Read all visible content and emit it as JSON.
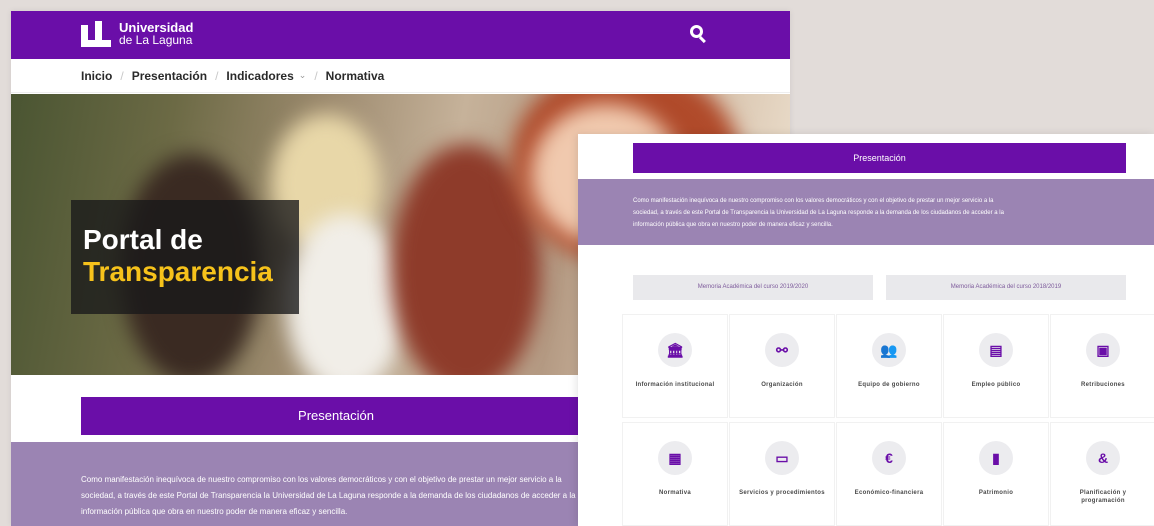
{
  "brand": {
    "line1": "Universidad",
    "line2": "de La Laguna",
    "color": "#6a0ea8"
  },
  "nav": {
    "items": [
      "Inicio",
      "Presentación",
      "Indicadores",
      "Normativa"
    ]
  },
  "hero": {
    "line1": "Portal de",
    "line2": "Transparencia"
  },
  "presentation": {
    "label": "Presentación",
    "text_lines": [
      "Como manifestación inequívoca de nuestro compromiso con los valores democráticos y con el objetivo de prestar un mejor servicio a la",
      "sociedad, a través de este Portal de Transparencia la Universidad de La Laguna responde a la demanda de los ciudadanos de acceder a la",
      "información pública que obra en nuestro poder de manera eficaz y sencilla."
    ]
  },
  "memorias": [
    "Memoria Académica del curso 2019/2020",
    "Memoria Académica del curso 2018/2019"
  ],
  "tiles": [
    {
      "label": "Información institucional",
      "icon": "bank-icon",
      "glyph": "🏛"
    },
    {
      "label": "Organización",
      "icon": "org-chart-icon",
      "glyph": "⚯"
    },
    {
      "label": "Equipo de gobierno",
      "icon": "team-icon",
      "glyph": "👥"
    },
    {
      "label": "Empleo público",
      "icon": "id-card-icon",
      "glyph": "▤"
    },
    {
      "label": "Retribuciones",
      "icon": "payslip-icon",
      "glyph": "▣"
    },
    {
      "label": "Normativa",
      "icon": "document-icon",
      "glyph": "▦"
    },
    {
      "label": "Servicios y procedimientos",
      "icon": "browser-window-icon",
      "glyph": "▭"
    },
    {
      "label": "Económico-financiera",
      "icon": "euro-icon",
      "glyph": "€"
    },
    {
      "label": "Patrimonio",
      "icon": "building-icon",
      "glyph": "▮"
    },
    {
      "label": "Planificación y programación",
      "icon": "ampersand-icon",
      "glyph": "&"
    }
  ]
}
